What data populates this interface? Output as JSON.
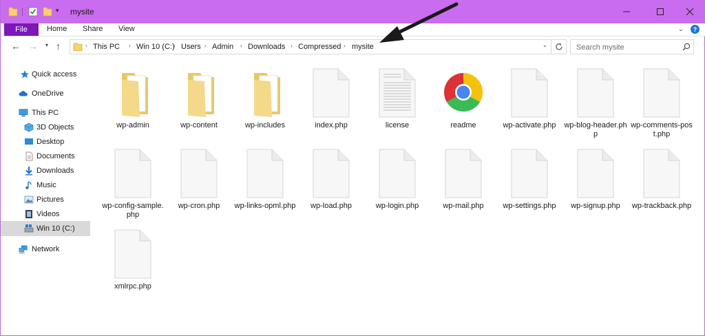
{
  "window": {
    "title": "mysite",
    "accent": "#c96cf0"
  },
  "ribbon": {
    "file": "File",
    "home": "Home",
    "share": "Share",
    "view": "View",
    "help": "?"
  },
  "address": {
    "crumbs": [
      "This PC",
      "Win 10 (C:)",
      "Users",
      "Admin",
      "Downloads",
      "Compressed",
      "mysite"
    ]
  },
  "search": {
    "placeholder": "Search mysite"
  },
  "sidebar": {
    "items": [
      {
        "label": "Quick access",
        "icon": "star-icon"
      },
      {
        "label": "OneDrive",
        "icon": "cloud-icon"
      },
      {
        "label": "This PC",
        "icon": "computer-icon"
      },
      {
        "label": "3D Objects",
        "icon": "cube-icon"
      },
      {
        "label": "Desktop",
        "icon": "desktop-icon"
      },
      {
        "label": "Documents",
        "icon": "document-icon"
      },
      {
        "label": "Downloads",
        "icon": "download-icon"
      },
      {
        "label": "Music",
        "icon": "music-icon"
      },
      {
        "label": "Pictures",
        "icon": "picture-icon"
      },
      {
        "label": "Videos",
        "icon": "video-icon"
      },
      {
        "label": "Win 10 (C:)",
        "icon": "drive-icon"
      },
      {
        "label": "Network",
        "icon": "network-icon"
      }
    ]
  },
  "files": [
    {
      "name": "wp-admin",
      "type": "folder"
    },
    {
      "name": "wp-content",
      "type": "folder"
    },
    {
      "name": "wp-includes",
      "type": "folder"
    },
    {
      "name": "index.php",
      "type": "file"
    },
    {
      "name": "license",
      "type": "text"
    },
    {
      "name": "readme",
      "type": "chrome"
    },
    {
      "name": "wp-activate.php",
      "type": "file"
    },
    {
      "name": "wp-blog-header.php",
      "type": "file"
    },
    {
      "name": "wp-comments-post.php",
      "type": "file"
    },
    {
      "name": "wp-config-sample.php",
      "type": "file"
    },
    {
      "name": "wp-cron.php",
      "type": "file"
    },
    {
      "name": "wp-links-opml.php",
      "type": "file"
    },
    {
      "name": "wp-load.php",
      "type": "file"
    },
    {
      "name": "wp-login.php",
      "type": "file"
    },
    {
      "name": "wp-mail.php",
      "type": "file"
    },
    {
      "name": "wp-settings.php",
      "type": "file"
    },
    {
      "name": "wp-signup.php",
      "type": "file"
    },
    {
      "name": "wp-trackback.php",
      "type": "file"
    },
    {
      "name": "xmlrpc.php",
      "type": "file"
    }
  ]
}
